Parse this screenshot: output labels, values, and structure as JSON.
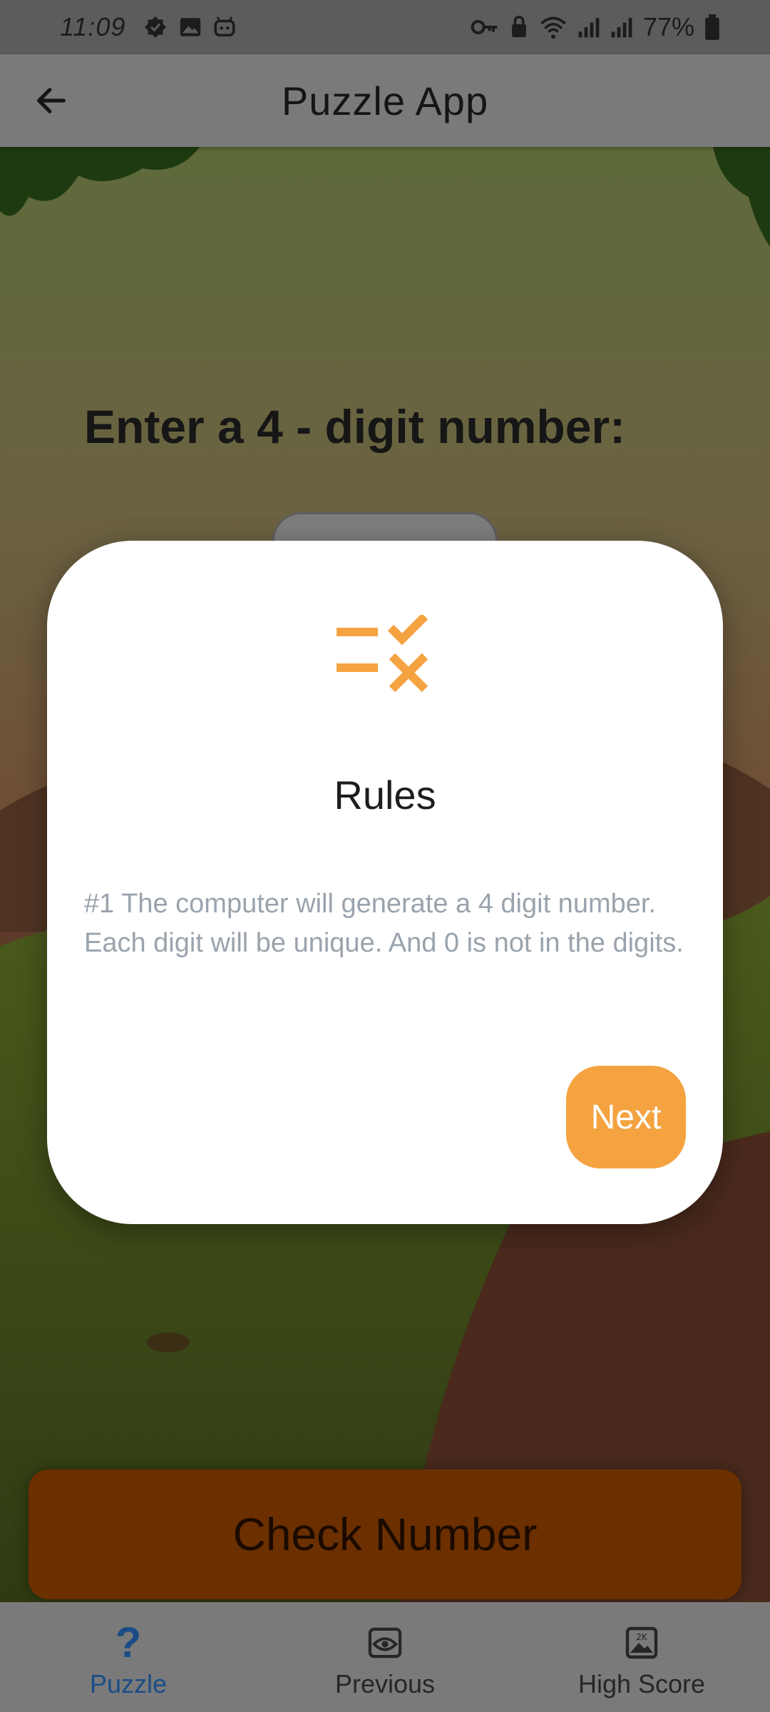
{
  "status_bar": {
    "time": "11:09",
    "battery": "77%",
    "icons": [
      "check-badge-icon",
      "gallery-icon",
      "robot-icon",
      "key-icon",
      "lock-icon",
      "wifi-icon",
      "signal-icon",
      "signal-icon",
      "battery-icon"
    ]
  },
  "app_bar": {
    "back_icon": "arrow-left-icon",
    "title": "Puzzle App"
  },
  "main": {
    "prompt": "Enter a 4 - digit number:",
    "check_button_label": "Check Number"
  },
  "dialog": {
    "icon": "checklist-icon",
    "title": "Rules",
    "text": "#1 The computer will generate a 4 digit number. Each digit will be unique. And 0 is not in the digits.",
    "next_label": "Next"
  },
  "bottom_nav": {
    "items": [
      {
        "label": "Puzzle",
        "icon": "question-mark-icon",
        "active": true
      },
      {
        "label": "Previous",
        "icon": "eye-icon",
        "active": false
      },
      {
        "label": "High Score",
        "icon": "image-icon",
        "active": false
      }
    ]
  },
  "colors": {
    "accent": "#f4a340",
    "active_nav": "#1a4d86",
    "check_button": "#6b2f00"
  }
}
